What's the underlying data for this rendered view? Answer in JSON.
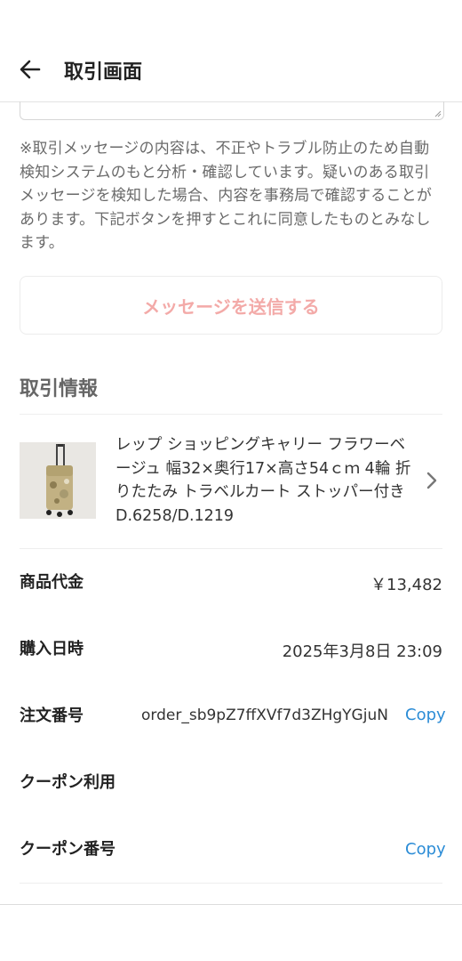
{
  "header": {
    "title": "取引画面",
    "back_icon": "arrow-left-icon"
  },
  "notice": "※取引メッセージの内容は、不正やトラブル防止のため自動検知システムのもと分析・確認しています。疑いのある取引メッセージを検知した場合、内容を事務局で確認することがあります。下記ボタンを押すとこれに同意したものとみなします。",
  "send_button": {
    "label": "メッセージを送信する"
  },
  "transaction": {
    "section_title": "取引情報",
    "product": {
      "name": "レップ ショッピングキャリー フラワーベージュ 幅32×奥行17×高さ54ｃｍ 4輪 折りたたみ トラベルカート ストッパー付き D.6258/D.1219"
    },
    "price_label": "商品代金",
    "price_value": "￥13,482",
    "purchase_label": "購入日時",
    "purchase_value": "2025年3月8日 23:09",
    "order_label": "注文番号",
    "order_value": "order_sb9pZ7ffXVf7d3ZHgYGjuN",
    "order_copy": "Copy",
    "coupon_use_label": "クーポン利用",
    "coupon_number_label": "クーポン番号",
    "coupon_copy": "Copy"
  },
  "colors": {
    "accent_link": "#2b8cd6",
    "send_button_text": "#f3aaa8"
  }
}
